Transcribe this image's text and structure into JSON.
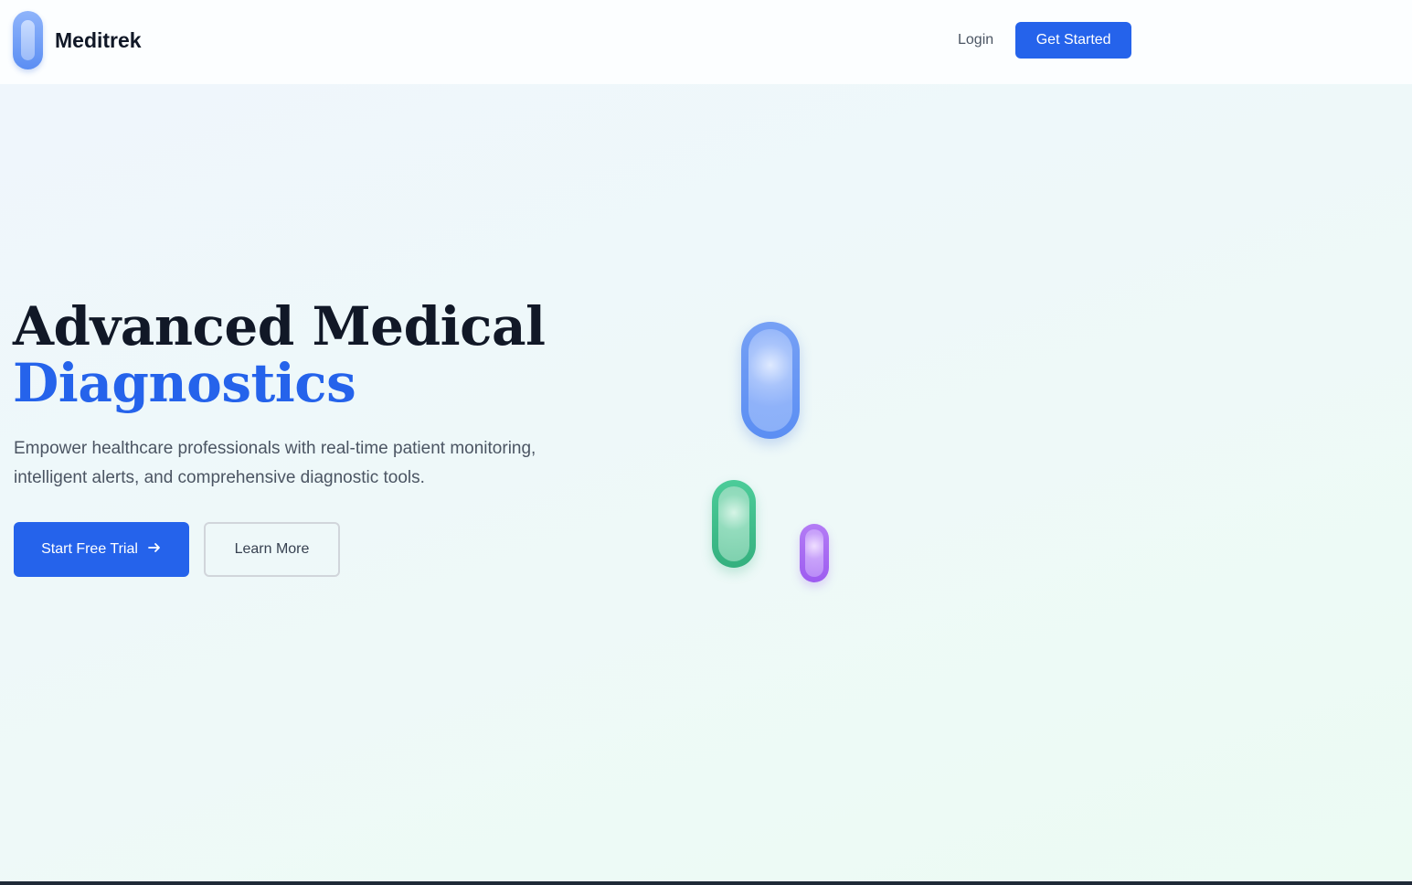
{
  "nav": {
    "brand": "Meditrek",
    "login": "Login",
    "get_started": "Get Started"
  },
  "hero": {
    "title_line1": "Advanced Medical",
    "title_line2": "Diagnostics",
    "description": "Empower healthcare professionals with real-time patient monitoring, intelligent alerts, and comprehensive diagnostic tools.",
    "cta_primary": "Start Free Trial",
    "cta_secondary": "Learn More"
  },
  "icons": {
    "brand_logo": "capsule-icon",
    "cta_primary": "arrow-right-icon",
    "decor": [
      "blue-capsule-icon",
      "green-capsule-icon",
      "purple-capsule-icon"
    ]
  },
  "colors": {
    "accent": "#2563eb",
    "heading": "#111827",
    "body_text": "#4b5563",
    "capsule_blue": "#5b8ef3",
    "capsule_green": "#34b07e",
    "capsule_purple": "#9d5cf0"
  }
}
